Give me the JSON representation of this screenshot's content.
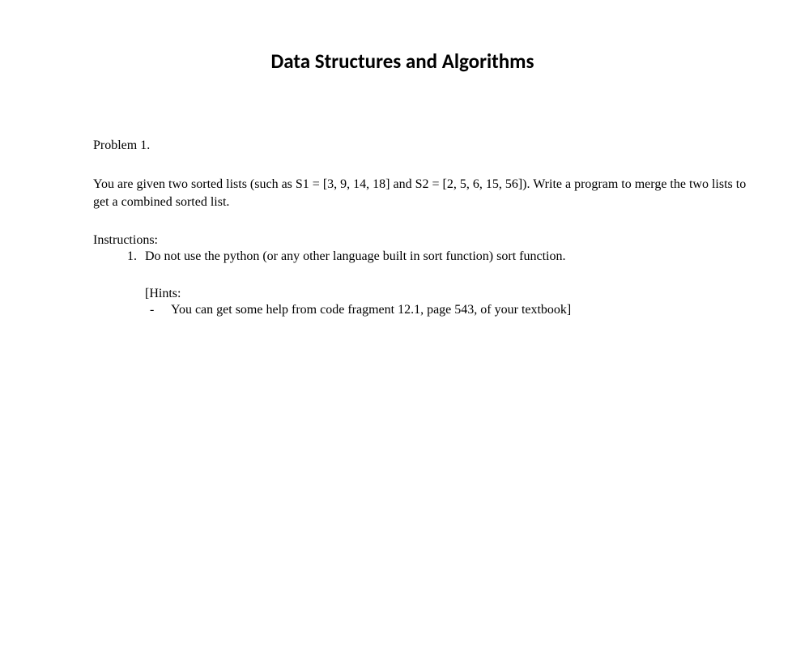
{
  "title": "Data Structures and Algorithms",
  "problem": {
    "label": "Problem 1.",
    "body": "You are given two sorted lists (such as S1 = [3, 9, 14, 18] and S2 = [2, 5, 6, 15, 56]). Write a program to merge the two lists to get a combined sorted list."
  },
  "instructions": {
    "label": "Instructions:",
    "items": [
      "Do not use the python (or any other language built in sort function) sort function."
    ]
  },
  "hints": {
    "label": "[Hints:",
    "items": [
      "You can get some help from code fragment 12.1, page 543, of your textbook]"
    ]
  }
}
